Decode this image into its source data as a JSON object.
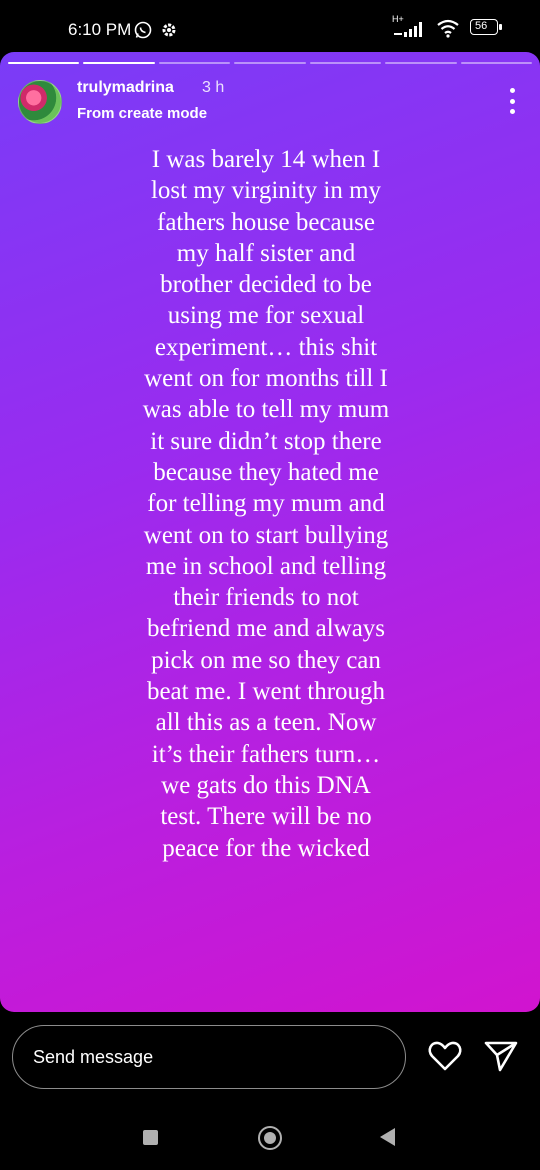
{
  "status_bar": {
    "time": "6:10 PM",
    "network": "H+",
    "battery": "56"
  },
  "story": {
    "username": "trulymadrina",
    "time_ago": "3 h",
    "subtitle": "From create mode",
    "progress": {
      "total_segments": 7,
      "completed_segments": 2
    },
    "text_lines": [
      "I was barely 14 when I",
      "lost my virginity in my",
      "fathers house because",
      "my half sister and",
      "brother decided to be",
      "using me for sexual",
      "experiment… this shit",
      "went on for months till I",
      "was able to tell my mum",
      "it sure didn’t stop there",
      "because they hated me",
      "for telling my mum and",
      "went on to start bullying",
      "me in school and telling",
      "their friends to not",
      "befriend me and always",
      "pick on me so they can",
      "beat me. I went through",
      "all this as a teen. Now",
      "it’s their fathers turn…",
      "we gats do this DNA",
      "test. There will be no",
      "peace for the wicked"
    ],
    "gradient": [
      "#7a3cf7",
      "#d114cf"
    ]
  },
  "reply": {
    "placeholder": "Send message"
  },
  "icons": {
    "whatsapp": "whatsapp-icon",
    "settings": "gear-icon",
    "signal": "signal-icon",
    "wifi": "wifi-icon",
    "battery": "battery-icon",
    "more": "more-vertical-icon",
    "like": "heart-icon",
    "share": "paper-plane-icon"
  }
}
